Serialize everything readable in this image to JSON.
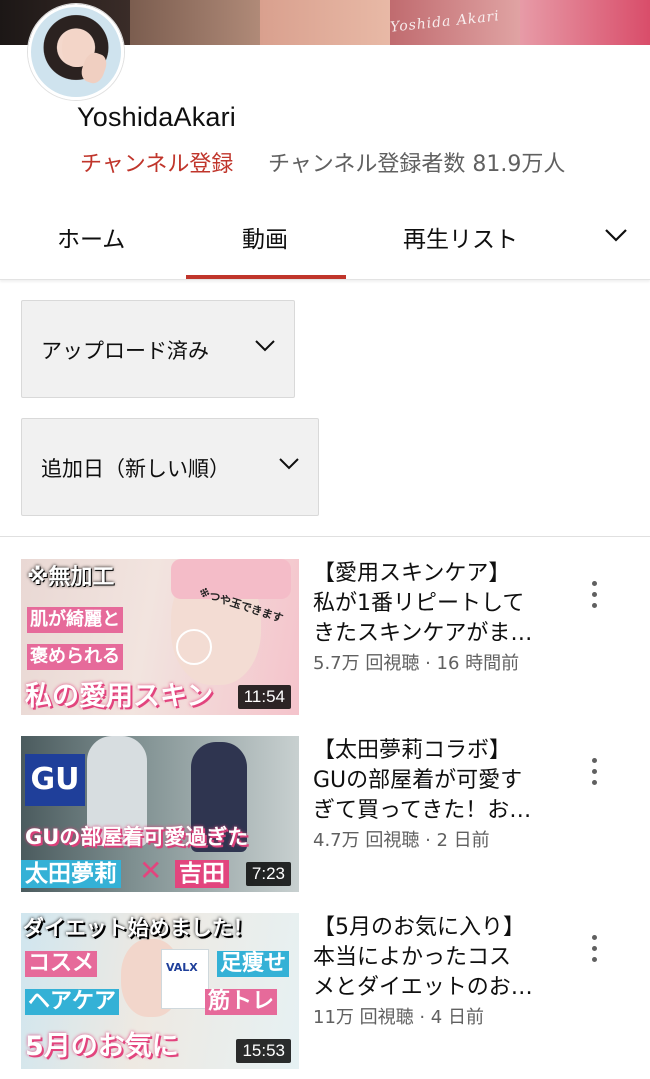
{
  "banner": {
    "text": "Yoshida Akari"
  },
  "channel": {
    "name": "YoshidaAkari",
    "subscribe_label": "チャンネル登録",
    "subscriber_count": "チャンネル登録者数 81.9万人"
  },
  "tabs": [
    {
      "label": "ホーム"
    },
    {
      "label": "動画",
      "active": true
    },
    {
      "label": "再生リスト"
    }
  ],
  "filters": {
    "type": "アップロード済み",
    "sort": "追加日（新しい順）"
  },
  "videos": [
    {
      "title_lines": [
        "【愛用スキンケア】",
        "私が1番リピートして",
        "きたスキンケアがま…"
      ],
      "meta": "5.7万 回視聴 · 16 時間前",
      "duration": "11:54",
      "thumb_text": [
        "※無加工",
        "肌が綺麗と",
        "褒められる",
        "私の愛用スキン",
        "※つや玉できます"
      ]
    },
    {
      "title_lines": [
        "【太田夢莉コラボ】",
        "GUの部屋着が可愛す",
        "ぎて買ってきた！お…"
      ],
      "meta": "4.7万 回視聴 · 2 日前",
      "duration": "7:23",
      "thumb_text": [
        "GU",
        "GUの部屋着可愛過ぎた",
        "太田夢莉",
        "✕",
        "吉田"
      ]
    },
    {
      "title_lines": [
        "【5月のお気に入り】",
        "本当によかったコス",
        "メとダイエットのお…"
      ],
      "meta": "11万 回視聴 · 4 日前",
      "duration": "15:53",
      "thumb_text": [
        "ダイエット始めました！",
        "コスメ",
        "足痩せ",
        "ヘアケア",
        "筋トレ",
        "5月のお気に",
        "VALX"
      ]
    }
  ],
  "colors": {
    "accent_red": "#c0352b",
    "text_secondary": "#606060",
    "filter_bg": "#f1f1f1"
  },
  "icons": [
    "chevron-down-icon",
    "more-vert-icon"
  ]
}
